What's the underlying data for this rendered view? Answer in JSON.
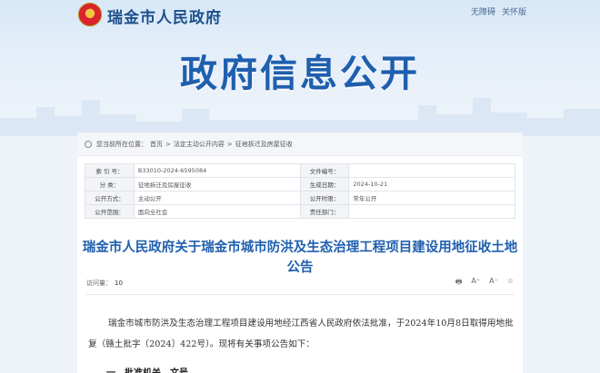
{
  "header": {
    "site_title": "瑞金市人民政府",
    "links": [
      "无障碍",
      "关怀版"
    ],
    "banner_title": "政府信息公开"
  },
  "breadcrumb": {
    "prefix": "您当前所在位置：",
    "items": [
      "首页",
      "法定主动公开内容",
      "征地拆迁及房屋征收"
    ],
    "separator": ">"
  },
  "meta": {
    "rows": [
      {
        "k1": "索 引 号：",
        "v1": "B33010-2024-6595084",
        "k2": "文件编号：",
        "v2": ""
      },
      {
        "k1": "分    类：",
        "v1": "征地拆迁及房屋征收",
        "k2": "生成日期：",
        "v2": "2024-10-21"
      },
      {
        "k1": "公开方式：",
        "v1": "主动公开",
        "k2": "公开时限：",
        "v2": "常年公开"
      },
      {
        "k1": "公开范围：",
        "v1": "面向全社会",
        "k2": "责任部门：",
        "v2": ""
      }
    ]
  },
  "document": {
    "title": "瑞金市人民政府关于瑞金市城市防洪及生态治理工程项目建设用地征收土地公告",
    "views_label": "访问量：",
    "views": "10",
    "tools": [
      "🖶",
      "A⁺",
      "A⁻",
      "☆"
    ],
    "paragraph": "瑞金市城市防洪及生态治理工程项目建设用地经江西省人民政府依法批准，于2024年10月8日取得用地批复（赣土批字〔2024〕422号）。现将有关事项公告如下：",
    "section_heading": "一、批准机关、文号"
  },
  "colors": {
    "brand_blue": "#1f5fae",
    "site_title": "#1d4f8c"
  }
}
